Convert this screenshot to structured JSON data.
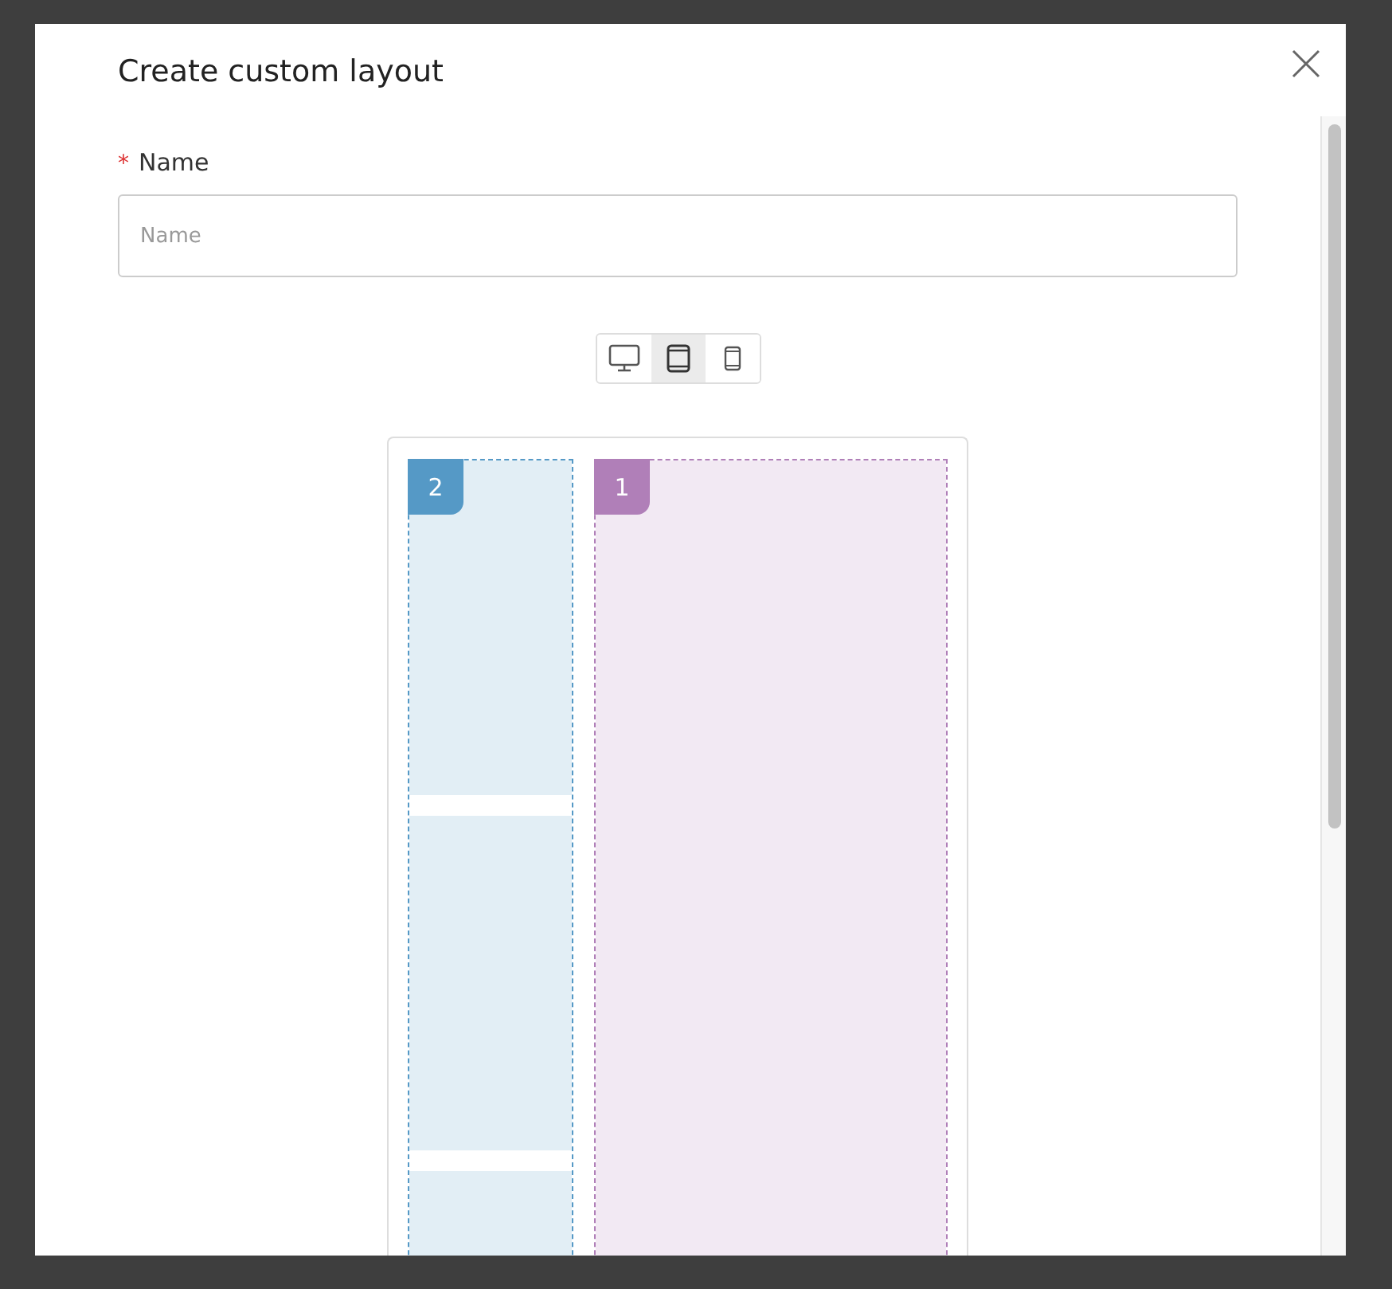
{
  "dialog": {
    "title": "Create custom layout",
    "name_field": {
      "label": "Name",
      "required_mark": "*",
      "placeholder": "Name"
    },
    "devices": [
      {
        "kind": "desktop",
        "selected": false
      },
      {
        "kind": "tablet",
        "selected": true
      },
      {
        "kind": "mobile",
        "selected": false
      }
    ],
    "regions": [
      {
        "number": "2",
        "color": "#5599c6",
        "kind": "stacked"
      },
      {
        "number": "1",
        "color": "#b07fb8",
        "kind": "single"
      }
    ]
  }
}
